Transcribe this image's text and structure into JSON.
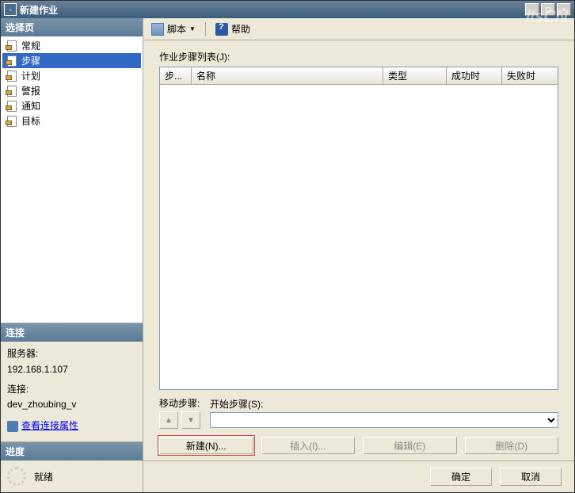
{
  "titlebar": {
    "title": "新建作业"
  },
  "left": {
    "select_page_header": "选择页",
    "nav": [
      {
        "label": "常规"
      },
      {
        "label": "步骤",
        "selected": true
      },
      {
        "label": "计划"
      },
      {
        "label": "警报"
      },
      {
        "label": "通知"
      },
      {
        "label": "目标"
      }
    ],
    "connection": {
      "header": "连接",
      "server_label": "服务器:",
      "server_value": "192.168.1.107",
      "conn_label": "连接:",
      "conn_value": "dev_zhoubing_v",
      "view_props": "查看连接属性"
    },
    "progress": {
      "header": "进度",
      "status": "就绪"
    }
  },
  "toolbar": {
    "script_label": "脚本",
    "help_label": "帮助"
  },
  "main": {
    "step_list_label": "作业步骤列表(J):",
    "columns": {
      "step": "步...",
      "name": "名称",
      "type": "类型",
      "success": "成功时",
      "fail": "失败时"
    },
    "move_label": "移动步骤:",
    "start_step_label": "开始步骤(S):",
    "buttons": {
      "new": "新建(N)...",
      "insert": "插入(I)...",
      "edit": "编辑(E)",
      "delete": "删除(D)"
    }
  },
  "footer": {
    "ok": "确定",
    "cancel": "取消"
  },
  "watermark": "ItsCN"
}
